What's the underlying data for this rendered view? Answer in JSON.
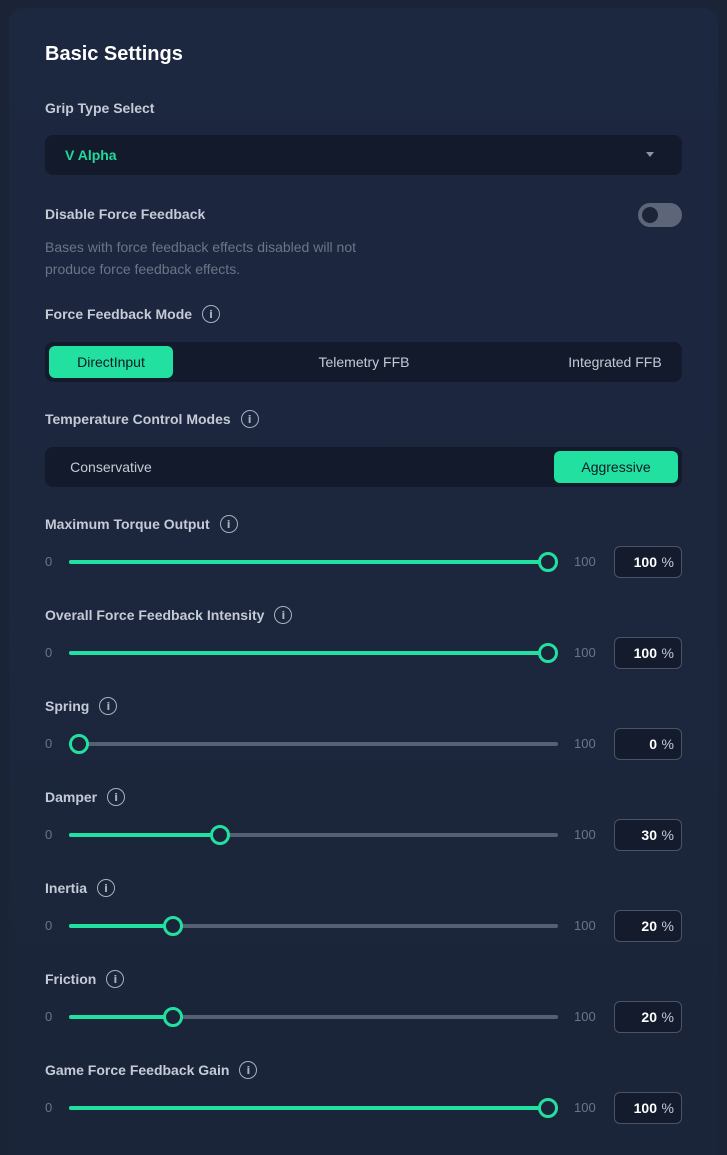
{
  "title": "Basic Settings",
  "grip": {
    "label": "Grip Type Select",
    "value": "V Alpha"
  },
  "ffb_disable": {
    "label": "Disable Force Feedback",
    "description": "Bases with force feedback effects disabled will not produce force feedback effects.",
    "enabled": false
  },
  "ffb_mode": {
    "label": "Force Feedback Mode",
    "options": [
      "DirectInput",
      "Telemetry FFB",
      "Integrated FFB"
    ],
    "selected": "DirectInput"
  },
  "temp_mode": {
    "label": "Temperature Control Modes",
    "options": [
      "Conservative",
      "Aggressive"
    ],
    "selected": "Aggressive"
  },
  "sliders": [
    {
      "label": "Maximum Torque Output",
      "min": "0",
      "max": "100",
      "value": "100",
      "unit": "%"
    },
    {
      "label": "Overall Force Feedback Intensity",
      "min": "0",
      "max": "100",
      "value": "100",
      "unit": "%"
    },
    {
      "label": "Spring",
      "min": "0",
      "max": "100",
      "value": "0",
      "unit": "%"
    },
    {
      "label": "Damper",
      "min": "0",
      "max": "100",
      "value": "30",
      "unit": "%"
    },
    {
      "label": "Inertia",
      "min": "0",
      "max": "100",
      "value": "20",
      "unit": "%"
    },
    {
      "label": "Friction",
      "min": "0",
      "max": "100",
      "value": "20",
      "unit": "%"
    },
    {
      "label": "Game Force Feedback Gain",
      "min": "0",
      "max": "100",
      "value": "100",
      "unit": "%"
    }
  ],
  "icons": {
    "info": "info-icon",
    "dropdown": "chevron-down-icon"
  },
  "colors": {
    "accent": "#22e0a0",
    "panel": "#1b2539",
    "inactive_track": "#566074"
  }
}
